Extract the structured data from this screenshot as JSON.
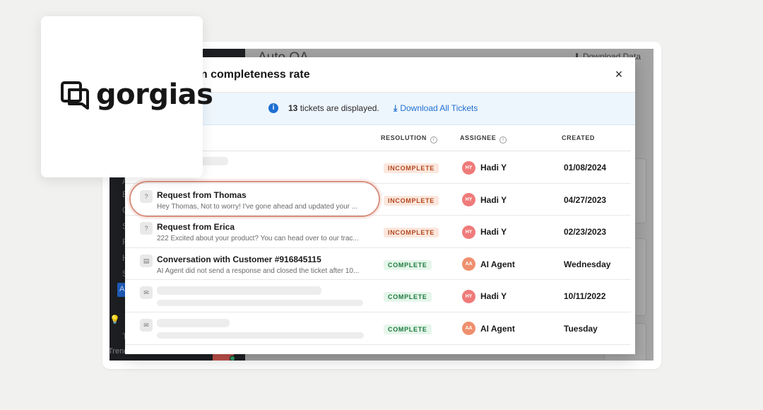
{
  "background_app": {
    "page_title": "Auto QA",
    "download_data_label": "Download Data",
    "sidebar_letters": [
      "A",
      "E",
      "C",
      "S",
      "F",
      "H",
      "S",
      "T"
    ],
    "sidebar_active_letter": "A",
    "sidebar_bottom_text": "Trend"
  },
  "modal": {
    "title": "Resolution completeness rate",
    "close_label": "×",
    "info": {
      "icon": "i",
      "count": "13",
      "text_suffix": " tickets are displayed.",
      "download_label": "Download All Tickets"
    },
    "columns": {
      "resolution": "RESOLUTION",
      "assignee": "ASSIGNEE",
      "created": "CREATED"
    },
    "rows": [
      {
        "channel_icon": "email-icon",
        "subject": "",
        "preview": "",
        "resolution": "INCOMPLETE",
        "assignee_initials": "HY",
        "assignee": "Hadi Y",
        "created": "01/08/2024"
      },
      {
        "channel_icon": "help-icon",
        "subject": "Request from Thomas",
        "preview": "Hey Thomas, Not to worry! I've gone ahead and updated your ...",
        "resolution": "INCOMPLETE",
        "assignee_initials": "HY",
        "assignee": "Hadi Y",
        "created": "04/27/2023"
      },
      {
        "channel_icon": "help-icon",
        "subject": "Request from Erica",
        "preview": "222 Excited about your product? You can head over to our trac...",
        "resolution": "INCOMPLETE",
        "assignee_initials": "HY",
        "assignee": "Hadi Y",
        "created": "02/23/2023"
      },
      {
        "channel_icon": "chat-icon",
        "subject": "Conversation with Customer #916845115",
        "preview": "AI Agent did not send a response and closed the ticket after 10...",
        "resolution": "COMPLETE",
        "assignee_initials": "AA",
        "assignee": "AI Agent",
        "created": "Wednesday"
      },
      {
        "channel_icon": "email-icon",
        "subject": "",
        "preview": "",
        "resolution": "COMPLETE",
        "assignee_initials": "HY",
        "assignee": "Hadi Y",
        "created": "10/11/2022"
      },
      {
        "channel_icon": "email-icon",
        "subject": "",
        "preview": "",
        "resolution": "COMPLETE",
        "assignee_initials": "AA",
        "assignee": "AI Agent",
        "created": "Tuesday"
      }
    ]
  },
  "logo": {
    "text": "gorgias",
    "icon": "gorgias-logo-icon"
  },
  "colors": {
    "accent": "#1f6fd1",
    "incomplete_bg": "#fbe7dd",
    "incomplete_text": "#b3461c",
    "complete_bg": "#e5f6ea",
    "complete_text": "#1d7a3e",
    "highlight": "#d9907e"
  }
}
